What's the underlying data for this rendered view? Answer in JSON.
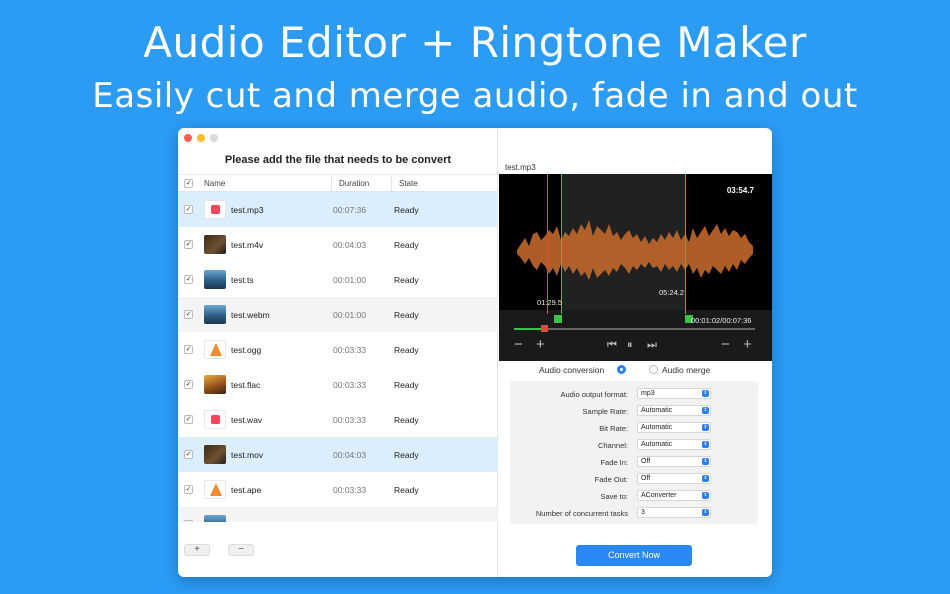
{
  "headline": {
    "title": "Audio Editor + Ringtone Maker",
    "subtitle": "Easily cut and merge audio, fade in and out"
  },
  "left_panel": {
    "title": "Please add the file that needs to be convert",
    "columns": {
      "name": "Name",
      "duration": "Duration",
      "state": "State"
    },
    "files": [
      {
        "name": "test.mp3",
        "duration": "00:07:36",
        "state": "Ready",
        "icon": "music-file-icon",
        "checked": "✓"
      },
      {
        "name": "test.m4v",
        "duration": "00:04:03",
        "state": "Ready",
        "icon": "video-thumbnail-icon",
        "checked": "✓"
      },
      {
        "name": "test.ts",
        "duration": "00:01:00",
        "state": "Ready",
        "icon": "video-thumbnail-icon",
        "checked": "✓"
      },
      {
        "name": "test.webm",
        "duration": "00:01:00",
        "state": "Ready",
        "icon": "video-thumbnail-icon",
        "checked": "✓"
      },
      {
        "name": "test.ogg",
        "duration": "00:03:33",
        "state": "Ready",
        "icon": "vlc-cone-icon",
        "checked": "✓"
      },
      {
        "name": "test.flac",
        "duration": "00:03:33",
        "state": "Ready",
        "icon": "album-art-icon",
        "checked": "✓"
      },
      {
        "name": "test.wav",
        "duration": "00:03:33",
        "state": "Ready",
        "icon": "music-file-icon",
        "checked": "✓"
      },
      {
        "name": "test.mov",
        "duration": "00:04:03",
        "state": "Ready",
        "icon": "video-thumbnail-icon",
        "checked": "✓"
      },
      {
        "name": "test.ape",
        "duration": "00:03:33",
        "state": "Ready",
        "icon": "vlc-cone-icon",
        "checked": "✓"
      }
    ],
    "add_label": "+",
    "remove_label": "−"
  },
  "player": {
    "file_name": "test.mp3",
    "total_time": "03:54.7",
    "start_time": "01:29.5",
    "selection_length": "05:24.2",
    "position": "00:01:02/00:07:36"
  },
  "mode": {
    "conversion_label": "Audio conversion",
    "merge_label": "Audio merge",
    "selected": "Audio conversion"
  },
  "settings": [
    {
      "label": "Audio output format:",
      "value": "mp3"
    },
    {
      "label": "Sample Rate:",
      "value": "Automatic"
    },
    {
      "label": "Bit Rate:",
      "value": "Automatic"
    },
    {
      "label": "Channel:",
      "value": "Automatic"
    },
    {
      "label": "Fade In:",
      "value": "Off"
    },
    {
      "label": "Fade Out:",
      "value": "Off"
    },
    {
      "label": "Save to:",
      "value": "AConverter"
    },
    {
      "label": "Number of concurrent tasks",
      "value": "3"
    }
  ],
  "convert_label": "Convert Now",
  "colors": {
    "background": "#2b9bf4",
    "accent": "#2a88f5",
    "waveform": "#c2672a",
    "selection_marker": "#3cc24a",
    "playhead": "#e24b3b"
  }
}
